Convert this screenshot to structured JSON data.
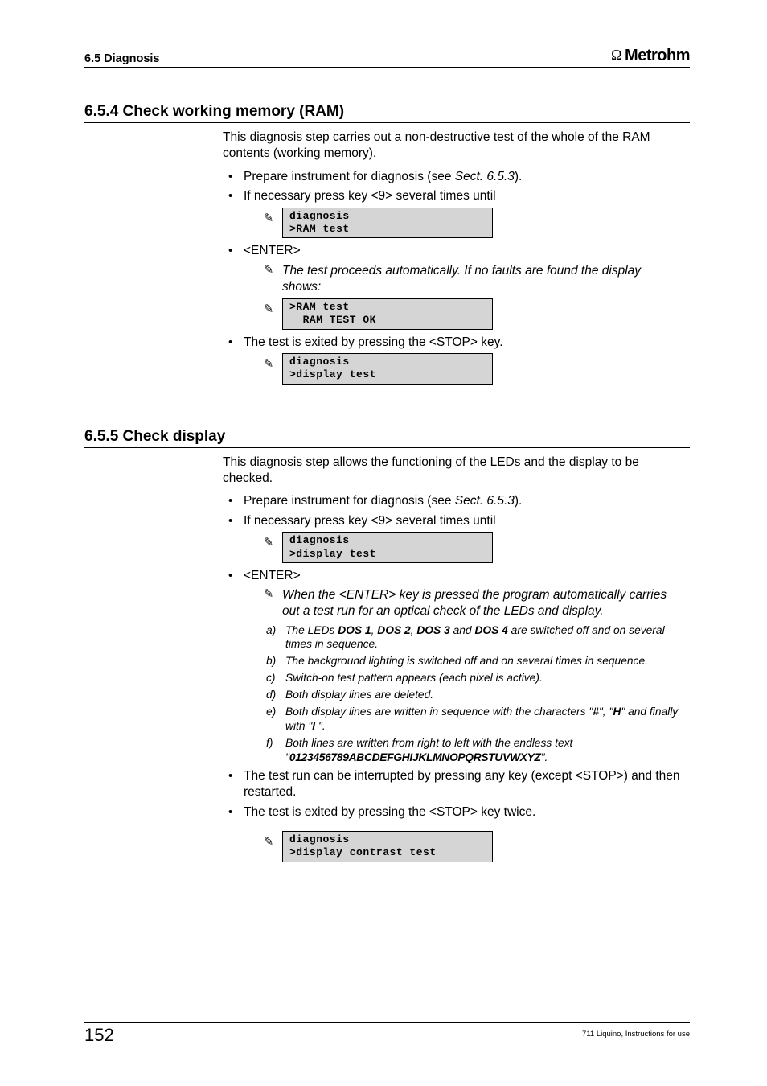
{
  "header": {
    "left": "6.5 Diagnosis",
    "brand_prefix": "Ω",
    "brand": "Metrohm"
  },
  "s654": {
    "title": "6.5.4  Check working memory (RAM)",
    "intro": "This diagnosis step carries out a non-destructive test of the whole of the RAM contents (working memory).",
    "b1a": "Prepare instrument for diagnosis (see ",
    "b1b": "Sect. 6.5.3",
    "b1c": ").",
    "b2": "If necessary press key <9> several times until",
    "lcd1_l1": "diagnosis",
    "lcd1_l2": ">RAM test",
    "b3": "<ENTER>",
    "sub1": "The test proceeds automatically. If no faults are found the display shows:",
    "lcd2_l1": ">RAM test",
    "lcd2_l2": "  RAM TEST OK",
    "b4": "The test is exited by pressing the <STOP> key.",
    "lcd3_l1": "diagnosis",
    "lcd3_l2": ">display test"
  },
  "s655": {
    "title": "6.5.5  Check display",
    "intro": "This diagnosis step allows the functioning of the LEDs and the display to be checked.",
    "b1a": "Prepare instrument for diagnosis (see ",
    "b1b": "Sect. 6.5.3",
    "b1c": ").",
    "b2": "If necessary press key <9> several times until",
    "lcd1_l1": "diagnosis",
    "lcd1_l2": ">display test",
    "b3": "<ENTER>",
    "sub1": "When the <ENTER> key is pressed the program automatically carries out a test run for an optical check of the LEDs and display.",
    "steps": {
      "a_pre": "The LEDs ",
      "a_d1": "DOS 1",
      "a_c1": ", ",
      "a_d2": "DOS 2",
      "a_c2": ", ",
      "a_d3": "DOS 3",
      "a_mid": " and ",
      "a_d4": "DOS 4",
      "a_post": " are switched off and on several times in sequence.",
      "b": "The background lighting is switched off and on several times in sequence.",
      "c": "Switch-on test pattern appears (each pixel is active).",
      "d": "Both display lines are deleted.",
      "e_pre": "Both display lines are written in sequence with the characters \"",
      "e_hash": "#",
      "e_mid1": "\", \"",
      "e_H": "H",
      "e_mid2": "\" and finally with \"",
      "e_I": "I",
      "e_post": " \".",
      "f_pre": "Both lines are written from right to left with the endless text \"",
      "f_txt": "0123456789ABCDEFGHIJKLMNOPQRSTUVWXYZ",
      "f_post": "\"."
    },
    "b4": "The test run can be interrupted by pressing any key (except <STOP>) and then restarted.",
    "b5": "The test is exited by pressing the <STOP> key twice.",
    "lcd2_l1": "diagnosis",
    "lcd2_l2": ">display contrast test"
  },
  "footer": {
    "page": "152",
    "right": "711 Liquino, Instructions for use"
  },
  "glyphs": {
    "hand": "✎"
  }
}
